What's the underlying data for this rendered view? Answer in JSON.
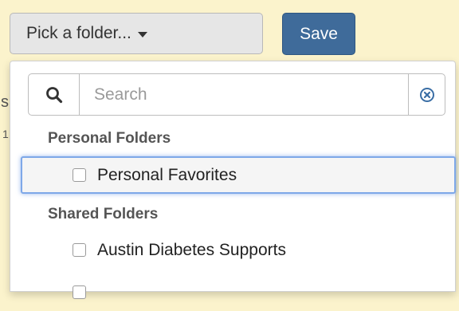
{
  "toolbar": {
    "folder_picker_label": "Pick a folder...",
    "save_label": "Save"
  },
  "search": {
    "placeholder": "Search",
    "value": ""
  },
  "groups": [
    {
      "header": "Personal Folders",
      "items": [
        {
          "label": "Personal Favorites",
          "checked": false,
          "highlighted": true
        }
      ]
    },
    {
      "header": "Shared Folders",
      "items": [
        {
          "label": "Austin Diabetes Supports",
          "checked": false,
          "highlighted": false
        }
      ]
    }
  ],
  "colors": {
    "page_background": "#fbf3cc",
    "save_button": "#3f6b9a",
    "focus_ring": "#7ea8e8",
    "clear_icon": "#3a6ea5"
  }
}
